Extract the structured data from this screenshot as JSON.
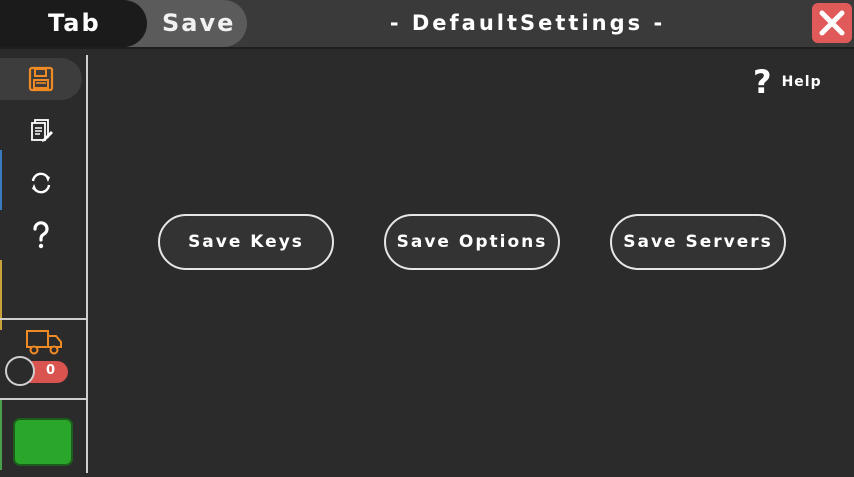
{
  "header": {
    "tabs": [
      {
        "label": "Tab"
      },
      {
        "label": "Save"
      }
    ],
    "title": "- DefaultSettings -",
    "close_icon": "close-icon"
  },
  "sidebar": {
    "items": [
      {
        "icon": "floppy-disk-icon",
        "active": true
      },
      {
        "icon": "edit-document-icon"
      },
      {
        "icon": "refresh-icon"
      },
      {
        "icon": "question-icon"
      }
    ],
    "truck_icon": "truck-icon",
    "toggle_value": "0",
    "status_color": "#2aa72a"
  },
  "main": {
    "help": {
      "icon": "?",
      "label": "Help"
    },
    "buttons": [
      {
        "label": "Save Keys"
      },
      {
        "label": "Save Options"
      },
      {
        "label": "Save Servers"
      }
    ]
  },
  "colors": {
    "background": "#2b2b2b",
    "accent_orange": "#f08a24",
    "close_red": "#e05a5a",
    "toggle_red": "#d9534f"
  }
}
